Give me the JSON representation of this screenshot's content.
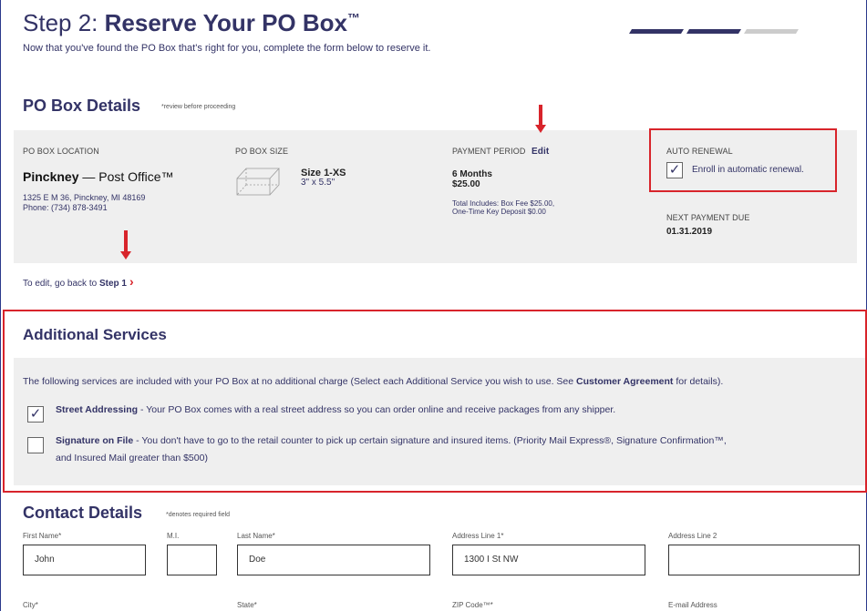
{
  "header": {
    "step_prefix": "Step 2: ",
    "title": "Reserve Your PO Box",
    "tm": "™",
    "subtitle": "Now that you've found the PO Box that's right for you, complete the form below to reserve it.",
    "progress_steps": [
      {
        "color": "#333366",
        "active": true
      },
      {
        "color": "#333366",
        "active": true
      },
      {
        "color": "#cccccc",
        "active": false
      }
    ]
  },
  "po_box_details": {
    "heading": "PO Box Details",
    "note": "*review before proceeding",
    "location": {
      "label": "PO BOX LOCATION",
      "name": "Pinckney",
      "type": "Post Office™",
      "address": "1325 E M 36, Pinckney, MI 48169",
      "phone": "Phone: (734) 878-3491"
    },
    "size": {
      "label": "PO BOX SIZE",
      "name": "Size 1-XS",
      "dimensions": "3\" x 5.5\"",
      "icon": "box-outline-icon"
    },
    "payment": {
      "label": "PAYMENT PERIOD",
      "edit": "Edit",
      "period": "6 Months",
      "amount": "$25.00",
      "includes_line1": "Total Includes: Box Fee $25.00,",
      "includes_line2": "One-Time Key Deposit $0.00"
    },
    "auto_renewal": {
      "label": "AUTO RENEWAL",
      "checkbox_label": "Enroll in automatic renewal.",
      "checked": true
    },
    "next_payment": {
      "label": "NEXT PAYMENT DUE",
      "date": "01.31.2019"
    },
    "edit_hint": "To edit, go back to ",
    "edit_link": "Step 1",
    "chevron": "›"
  },
  "additional_services": {
    "heading": "Additional Services",
    "intro_before": "The following services are included with your PO Box at no additional charge (Select each Additional Service you wish to use. See ",
    "intro_link": "Customer Agreement",
    "intro_after": " for details).",
    "services": [
      {
        "name": "Street Addressing",
        "description": " - Your PO Box comes with a real street address so you can order online and receive packages from any shipper.",
        "description_line2": "",
        "checked": true
      },
      {
        "name": "Signature on File",
        "description": " - You don't have to go to the retail counter to pick up certain signature and insured items. (Priority Mail Express®, Signature Confirmation™,",
        "description_line2": "and Insured Mail greater than $500)",
        "checked": false
      }
    ]
  },
  "contact_details": {
    "heading": "Contact Details",
    "note": "*denotes required field",
    "fields": [
      {
        "label": "First Name*",
        "value": "John"
      },
      {
        "label": "M.I.",
        "value": ""
      },
      {
        "label": "Last Name*",
        "value": "Doe"
      },
      {
        "label": "Address Line 1*",
        "value": "1300 I St NW"
      },
      {
        "label": "Address Line 2",
        "value": ""
      }
    ],
    "next_row_labels": [
      "City*",
      "State*",
      "ZIP Code™*",
      "E-mail Address"
    ]
  },
  "annotations": {
    "accent_red": "#d8242b",
    "navy": "#333366"
  }
}
